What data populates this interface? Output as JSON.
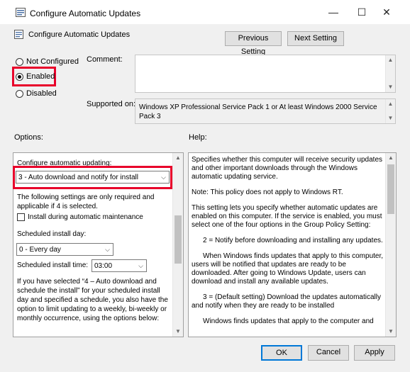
{
  "window": {
    "title": "Configure Automatic Updates",
    "minimize": "—",
    "maximize": "☐",
    "close": "✕"
  },
  "header": {
    "policy_name": "Configure Automatic Updates",
    "prev_button": "Previous Setting",
    "next_button": "Next Setting"
  },
  "state": {
    "options": [
      "Not Configured",
      "Enabled",
      "Disabled"
    ],
    "selected": "Enabled"
  },
  "comment": {
    "label": "Comment:",
    "value": ""
  },
  "supported": {
    "label": "Supported on:",
    "value": "Windows XP Professional Service Pack 1 or At least Windows 2000 Service Pack 3"
  },
  "options_label": "Options:",
  "help_label": "Help:",
  "options_panel": {
    "configure_label": "Configure automatic updating:",
    "configure_value": "3 - Auto download and notify for install",
    "note": "The following settings are only required and applicable if 4 is selected.",
    "maintenance_label": "Install during automatic maintenance",
    "maintenance_checked": false,
    "day_label": "Scheduled install day:",
    "day_value": "0 - Every day",
    "time_label": "Scheduled install time:",
    "time_value": "03:00",
    "para": "If you have selected “4 – Auto download and schedule the install” for your scheduled install day and specified a schedule, you also have the option to limit updating to a weekly, bi-weekly or monthly occurrence, using the options below:"
  },
  "help_panel": {
    "paragraphs": [
      "Specifies whether this computer will receive security updates and other important downloads through the Windows automatic updating service.",
      "Note: This policy does not apply to Windows RT.",
      "This setting lets you specify whether automatic updates are enabled on this computer. If the service is enabled, you must select one of the four options in the Group Policy Setting:",
      "2 = Notify before downloading and installing any updates.",
      "When Windows finds updates that apply to this computer, users will be notified that updates are ready to be downloaded. After going to Windows Update, users can download and install any available updates.",
      "3 = (Default setting) Download the updates automatically and notify when they are ready to be installed",
      "Windows finds updates that apply to the computer and"
    ]
  },
  "footer": {
    "ok": "OK",
    "cancel": "Cancel",
    "apply": "Apply"
  }
}
